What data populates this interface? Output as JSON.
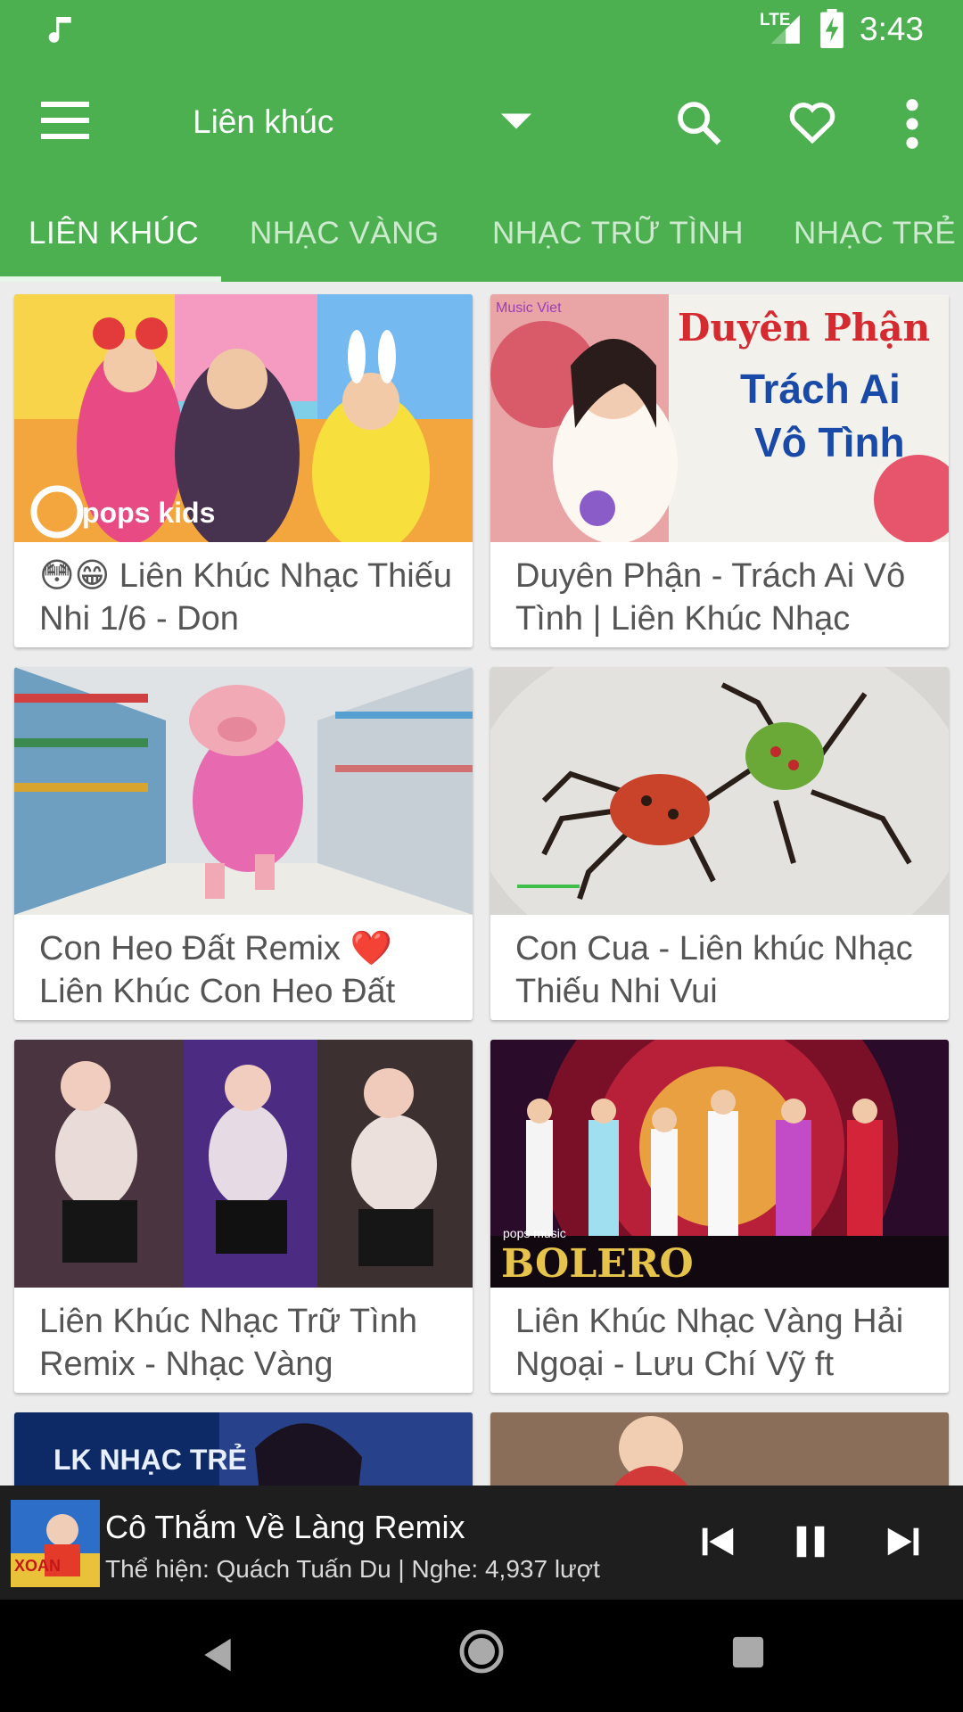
{
  "status_bar": {
    "network": "LTE",
    "time": "3:43",
    "icons": [
      "music-note-icon",
      "signal-icon",
      "battery-charging-icon"
    ]
  },
  "app_bar": {
    "title": "Liên khúc",
    "icons": [
      "menu-icon",
      "dropdown-arrow-icon",
      "search-icon",
      "heart-icon",
      "more-vert-icon"
    ]
  },
  "tabs": [
    {
      "label": "LIÊN KHÚC",
      "active": true
    },
    {
      "label": "NHẠC VÀNG",
      "active": false
    },
    {
      "label": "NHẠC TRỮ TÌNH",
      "active": false
    },
    {
      "label": "NHẠC TRẺ C",
      "active": false
    }
  ],
  "videos": [
    {
      "caption": "😳😁 Liên Khúc Nhạc Thiếu Nhi 1/6 - Don",
      "thumb_text": "pops kids"
    },
    {
      "caption": "Duyên Phận - Trách Ai Vô Tình | Liên Khúc Nhạc",
      "thumb_text": "Music Viet",
      "thumb_title": [
        "Duyên Phận",
        "Trách Ai",
        "Vô Tình"
      ]
    },
    {
      "caption": "Con Heo Đất Remix ❤️ Liên Khúc Con Heo Đất",
      "thumb_text": ""
    },
    {
      "caption": "Con Cua - Liên khúc Nhạc Thiếu Nhi Vui",
      "thumb_text": ""
    },
    {
      "caption": "Liên Khúc Nhạc Trữ Tình Remix - Nhạc Vàng",
      "thumb_text": ""
    },
    {
      "caption": "Liên Khúc Nhạc Vàng Hải Ngoại - Lưu Chí Vỹ ft",
      "thumb_text": "BOLERO",
      "thumb_sub": "pops music"
    },
    {
      "caption": "",
      "thumb_text": "LK NHẠC TRẺ"
    },
    {
      "caption": "",
      "thumb_text": ""
    }
  ],
  "player": {
    "song": "Cô Thắm Về Làng Remix",
    "meta": "Thể hiện: Quách Tuấn Du | Nghe: 4,937 lượt",
    "art_text": "XOAN",
    "icons": [
      "skip-previous-icon",
      "pause-icon",
      "skip-next-icon"
    ]
  },
  "colors": {
    "primary": "#4caf50",
    "player_bg": "#1e1e1e",
    "caption_text": "#555555"
  }
}
